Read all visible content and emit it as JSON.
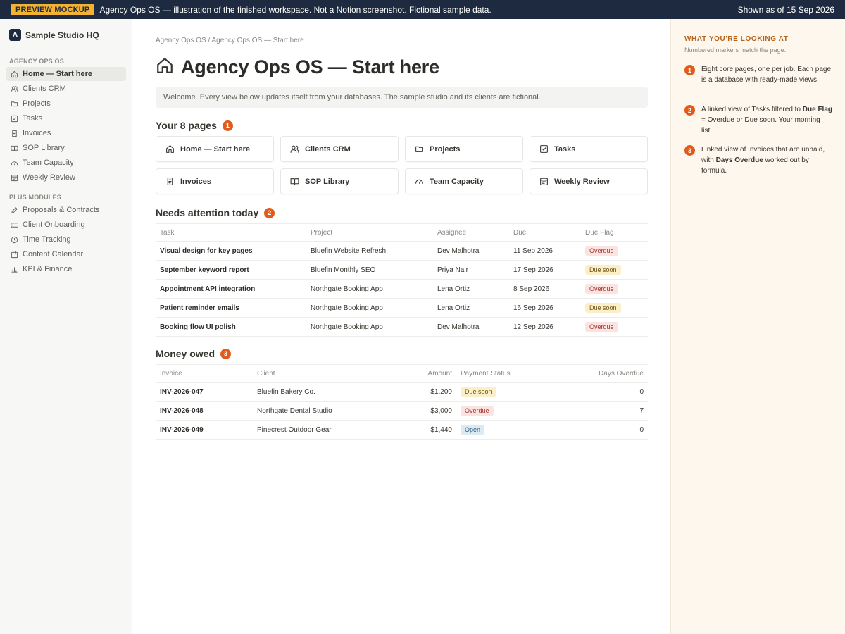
{
  "banner": {
    "tag": "PREVIEW MOCKUP",
    "message": "Agency Ops OS — illustration of the finished workspace. Not a Notion screenshot. Fictional sample data.",
    "as_of": "Shown as of 15 Sep 2026"
  },
  "sidebar": {
    "workspace_initial": "A",
    "workspace_name": "Sample Studio HQ",
    "section1": "AGENCY OPS OS",
    "items": [
      {
        "label": "Home — Start here",
        "icon": "home-icon"
      },
      {
        "label": "Clients CRM",
        "icon": "people-icon"
      },
      {
        "label": "Projects",
        "icon": "folder-icon"
      },
      {
        "label": "Tasks",
        "icon": "checkbox-icon"
      },
      {
        "label": "Invoices",
        "icon": "document-icon"
      },
      {
        "label": "SOP Library",
        "icon": "book-icon"
      },
      {
        "label": "Team Capacity",
        "icon": "gauge-icon"
      },
      {
        "label": "Weekly Review",
        "icon": "calendar-list-icon"
      }
    ],
    "section2": "PLUS MODULES",
    "modules": [
      {
        "label": "Proposals & Contracts",
        "icon": "pen-icon"
      },
      {
        "label": "Client Onboarding",
        "icon": "list-icon"
      },
      {
        "label": "Time Tracking",
        "icon": "clock-icon"
      },
      {
        "label": "Content Calendar",
        "icon": "calendar-icon"
      },
      {
        "label": "KPI & Finance",
        "icon": "bar-chart-icon"
      }
    ]
  },
  "main": {
    "breadcrumb": "Agency Ops OS / Agency Ops OS — Start here",
    "title": "Agency Ops OS — Start here",
    "callout": "Welcome. Every view below updates itself from your databases. The sample studio and its clients are fictional.",
    "pages_heading": "Your 8 pages",
    "pages_marker": "1",
    "pages": [
      {
        "label": "Home — Start here",
        "icon": "home-icon"
      },
      {
        "label": "Clients CRM",
        "icon": "people-icon"
      },
      {
        "label": "Projects",
        "icon": "folder-icon"
      },
      {
        "label": "Tasks",
        "icon": "checkbox-icon"
      },
      {
        "label": "Invoices",
        "icon": "document-icon"
      },
      {
        "label": "SOP Library",
        "icon": "book-icon"
      },
      {
        "label": "Team Capacity",
        "icon": "gauge-icon"
      },
      {
        "label": "Weekly Review",
        "icon": "calendar-list-icon"
      }
    ],
    "attention_heading": "Needs attention today",
    "attention_marker": "2",
    "attention_columns": [
      "Task",
      "Project",
      "Assignee",
      "Due",
      "Due Flag"
    ],
    "attention_rows": [
      {
        "task": "Visual design for key pages",
        "project": "Bluefin Website Refresh",
        "assignee": "Dev Malhotra",
        "due": "11 Sep 2026",
        "flag": "Overdue"
      },
      {
        "task": "September keyword report",
        "project": "Bluefin Monthly SEO",
        "assignee": "Priya Nair",
        "due": "17 Sep 2026",
        "flag": "Due soon"
      },
      {
        "task": "Appointment API integration",
        "project": "Northgate Booking App",
        "assignee": "Lena Ortiz",
        "due": "8 Sep 2026",
        "flag": "Overdue"
      },
      {
        "task": "Patient reminder emails",
        "project": "Northgate Booking App",
        "assignee": "Lena Ortiz",
        "due": "16 Sep 2026",
        "flag": "Due soon"
      },
      {
        "task": "Booking flow UI polish",
        "project": "Northgate Booking App",
        "assignee": "Dev Malhotra",
        "due": "12 Sep 2026",
        "flag": "Overdue"
      }
    ],
    "money_heading": "Money owed",
    "money_marker": "3",
    "money_columns": [
      "Invoice",
      "Client",
      "Amount",
      "Payment Status",
      "Days Overdue"
    ],
    "money_rows": [
      {
        "invoice": "INV-2026-047",
        "client": "Bluefin Bakery Co.",
        "amount": "$1,200",
        "status": "Due soon",
        "days": "0"
      },
      {
        "invoice": "INV-2026-048",
        "client": "Northgate Dental Studio",
        "amount": "$3,000",
        "status": "Overdue",
        "days": "7"
      },
      {
        "invoice": "INV-2026-049",
        "client": "Pinecrest Outdoor Gear",
        "amount": "$1,440",
        "status": "Open",
        "days": "0"
      }
    ]
  },
  "right_panel": {
    "title": "WHAT YOU'RE LOOKING AT",
    "subtitle": "Numbered markers match the page.",
    "notes": [
      {
        "marker": "1",
        "text": "Eight core pages, one per job. Each page is a database with ready-made views."
      },
      {
        "marker": "2",
        "text_a": "A linked view of Tasks filtered to ",
        "bold": "Due Flag",
        "text_b": " = Overdue or Due soon. Your morning list."
      },
      {
        "marker": "3",
        "text_a": "Linked view of Invoices that are unpaid, with ",
        "bold": "Days Overdue",
        "text_b": " worked out by formula."
      }
    ]
  },
  "colors": {
    "banner_bg": "#1e2a40",
    "banner_tag": "#f2b233",
    "marker": "#e25b1a",
    "overdue_bg": "#fbe3e1",
    "due_soon_bg": "#fbefc9",
    "open_bg": "#dcebf3",
    "panel_bg": "#fdf7ee"
  }
}
